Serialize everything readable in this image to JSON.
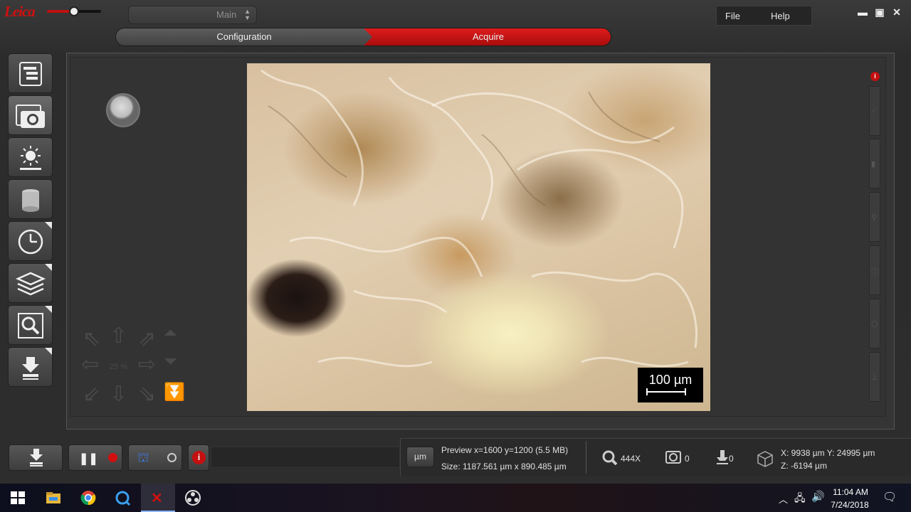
{
  "app": {
    "logo": "Leica",
    "mode_select": "Main",
    "steps": {
      "configuration": "Configuration",
      "acquire": "Acquire"
    },
    "menu": {
      "file": "File",
      "help": "Help"
    },
    "brightness_slider_level": 0.5
  },
  "colors": {
    "accent": "#c41010",
    "panel": "#333333",
    "bar": "#2a2a2a"
  },
  "left_toolbar": [
    {
      "name": "workflow-icon"
    },
    {
      "name": "camera-icon"
    },
    {
      "name": "illumination-icon"
    },
    {
      "name": "filter-icon"
    },
    {
      "name": "time-lapse-icon"
    },
    {
      "name": "z-stack-icon"
    },
    {
      "name": "zoom-inspect-icon"
    },
    {
      "name": "export-icon"
    }
  ],
  "nav_pad": {
    "zoom_label": "25 %"
  },
  "image": {
    "scalebar_label": "100 µm"
  },
  "status_bar": {
    "unit_button": "µm",
    "preview": "Preview x=1600 y=1200  (5.5 MB)",
    "size": "Size: 1187.561 µm x 890.485 µm",
    "magnification": "444X",
    "counter_1": "0",
    "counter_2": "0",
    "coords_xy": "X: 9938 µm Y: 24995 µm",
    "coords_z": "Z: -6194 µm"
  },
  "taskbar": {
    "time": "11:04 AM",
    "date": "7/24/2018"
  }
}
